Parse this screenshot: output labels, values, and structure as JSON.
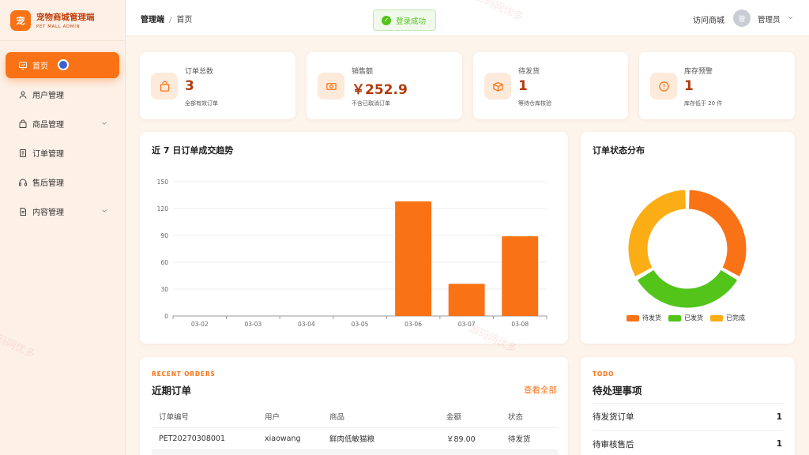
{
  "brand": {
    "logo": "宠",
    "title": "宠物商城管理端",
    "subtitle": "PET MALL ADMIN"
  },
  "sidebar": {
    "items": [
      {
        "label": "首页",
        "icon": "dashboard-icon",
        "active": true
      },
      {
        "label": "用户管理",
        "icon": "user-icon"
      },
      {
        "label": "商品管理",
        "icon": "bag-icon",
        "expandable": true
      },
      {
        "label": "订单管理",
        "icon": "document-icon"
      },
      {
        "label": "售后管理",
        "icon": "headset-icon"
      },
      {
        "label": "内容管理",
        "icon": "article-icon",
        "expandable": true
      }
    ]
  },
  "header": {
    "breadcrumb_root": "管理端",
    "breadcrumb_sep": "/",
    "breadcrumb_current": "首页",
    "toast": "登录成功",
    "visit_store": "访问商城",
    "avatar_text": "管",
    "admin_name": "管理员"
  },
  "stats": [
    {
      "label": "订单总数",
      "value": "3",
      "note": "全部有效订单",
      "icon": "bag-icon"
    },
    {
      "label": "销售额",
      "value": "￥252.9",
      "note": "不含已取消订单",
      "icon": "cash-icon"
    },
    {
      "label": "待发货",
      "value": "1",
      "note": "等待仓库核验",
      "icon": "box-icon"
    },
    {
      "label": "库存预警",
      "value": "1",
      "note": "库存低于 20 件",
      "icon": "alert-icon"
    }
  ],
  "trend": {
    "title": "近 7 日订单成交趋势"
  },
  "status_chart": {
    "title": "订单状态分布"
  },
  "chart_data": [
    {
      "type": "bar",
      "title": "近 7 日订单成交趋势",
      "categories": [
        "03-02",
        "03-03",
        "03-04",
        "03-05",
        "03-06",
        "03-07",
        "03-08"
      ],
      "values": [
        0,
        0,
        0,
        0,
        128,
        36,
        89
      ],
      "yticks": [
        0,
        30,
        60,
        90,
        120,
        150
      ],
      "ylim": [
        0,
        150
      ],
      "color": "#f97316",
      "grid": true
    },
    {
      "type": "pie",
      "title": "订单状态分布",
      "donut": true,
      "labels": [
        "待发货",
        "已发货",
        "已完成"
      ],
      "values": [
        1,
        1,
        1
      ],
      "colors": [
        "#f97316",
        "#52c41a",
        "#faad14"
      ],
      "legend": "bottom"
    }
  ],
  "orders": {
    "eyebrow": "RECENT ORDERS",
    "title": "近期订单",
    "view_all": "查看全部",
    "columns": [
      "订单编号",
      "用户",
      "商品",
      "金额",
      "状态"
    ],
    "rows": [
      [
        "PET20270308001",
        "xiaowang",
        "鲜肉低敏猫粮",
        "￥89.00",
        "待发货"
      ]
    ]
  },
  "todo": {
    "eyebrow": "TODO",
    "title": "待处理事项",
    "items": [
      {
        "label": "待发货订单",
        "count": "1"
      },
      {
        "label": "待审核售后",
        "count": "1"
      }
    ]
  },
  "watermark": "源码网优多"
}
